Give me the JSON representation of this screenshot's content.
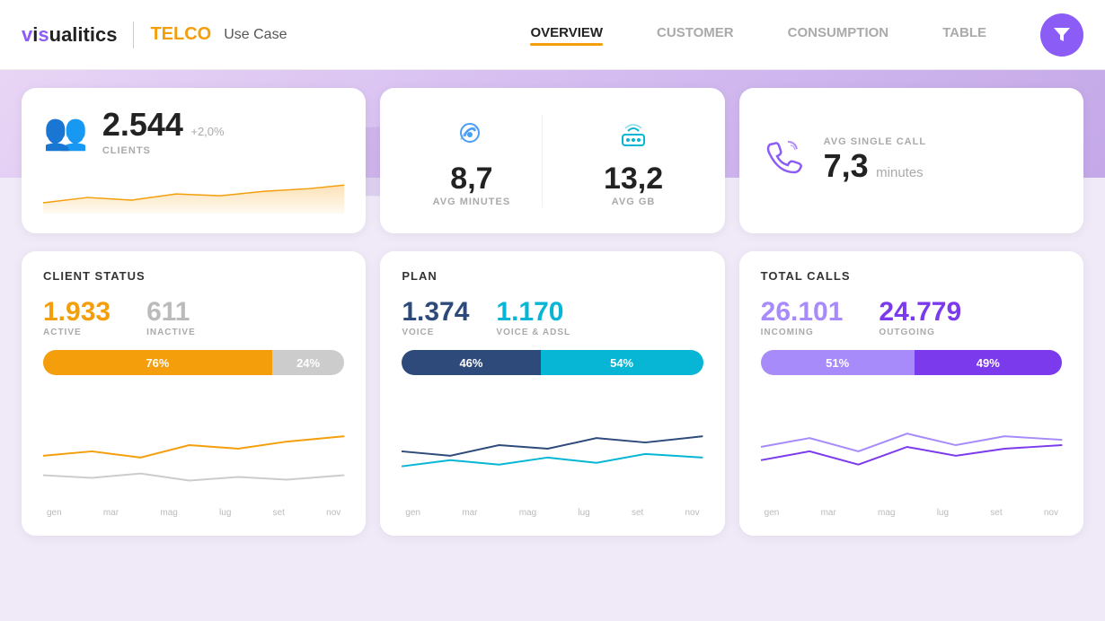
{
  "header": {
    "logo_vis": "visualitics",
    "logo_telco": "TELCO",
    "logo_usecase": "Use Case",
    "nav": [
      {
        "label": "OVERVIEW",
        "active": true
      },
      {
        "label": "CUSTOMER",
        "active": false
      },
      {
        "label": "CONSUMPTION",
        "active": false
      },
      {
        "label": "TABLE",
        "active": false
      }
    ]
  },
  "clients_card": {
    "number": "2.544",
    "change": "+2,0%",
    "label": "CLIENTS"
  },
  "avg_minutes": {
    "value": "8,7",
    "label": "AVG MINUTES"
  },
  "avg_gb": {
    "value": "13,2",
    "label": "AVG GB"
  },
  "avg_single_call": {
    "value": "7,3",
    "unit": "minutes",
    "label": "AVG SINGLE CALL"
  },
  "client_status": {
    "title": "CLIENT STATUS",
    "active_num": "1.933",
    "active_label": "ACTIVE",
    "inactive_num": "611",
    "inactive_label": "INACTIVE",
    "active_pct": "76%",
    "inactive_pct": "24%",
    "active_pct_val": 76,
    "inactive_pct_val": 24,
    "x_labels": [
      "gen",
      "mar",
      "mag",
      "lug",
      "set",
      "nov"
    ]
  },
  "plan": {
    "title": "PLAN",
    "voice_num": "1.374",
    "voice_label": "VOICE",
    "voice_adsl_num": "1.170",
    "voice_adsl_label": "VOICE & ADSL",
    "voice_pct": "46%",
    "voice_adsl_pct": "54%",
    "voice_pct_val": 46,
    "voice_adsl_pct_val": 54,
    "x_labels": [
      "gen",
      "mar",
      "mag",
      "lug",
      "set",
      "nov"
    ]
  },
  "total_calls": {
    "title": "TOTAL CALLS",
    "incoming_num": "26.101",
    "incoming_label": "INCOMING",
    "outgoing_num": "24.779",
    "outgoing_label": "OUTGOING",
    "incoming_pct": "51%",
    "outgoing_pct": "49%",
    "incoming_pct_val": 51,
    "outgoing_pct_val": 49,
    "x_labels": [
      "gen",
      "mar",
      "mag",
      "lug",
      "set",
      "nov"
    ]
  }
}
